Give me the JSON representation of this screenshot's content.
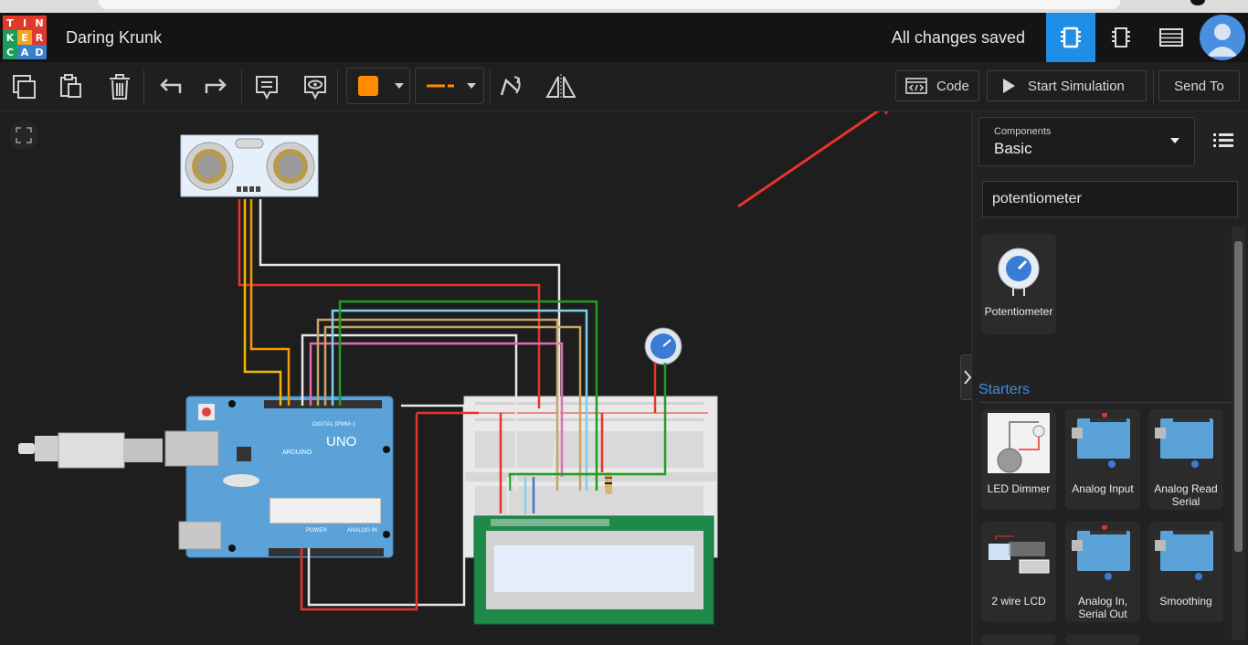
{
  "app": {
    "logo_letters": [
      "T",
      "I",
      "N",
      "K",
      "E",
      "R",
      "C",
      "A",
      "D"
    ],
    "logo_colors": [
      "#e0392b",
      "#e0392b",
      "#e0392b",
      "#1a9d5b",
      "#f2a31b",
      "#e0392b",
      "#1a9d5b",
      "#3a7fc8",
      "#3a7fc8"
    ],
    "title": "Daring Krunk",
    "status": "All changes saved"
  },
  "views": [
    {
      "name": "circuit-view",
      "active": true
    },
    {
      "name": "schematic-view",
      "active": false
    },
    {
      "name": "component-list-view",
      "active": false
    }
  ],
  "toolbar": {
    "tools": [
      "copy",
      "paste",
      "delete",
      "undo",
      "redo",
      "notes",
      "notes-visibility"
    ],
    "wire_color": "#ff8c00",
    "wire_type_color": "#ff8c00",
    "right_tools": [
      "rotate",
      "flip"
    ],
    "code_label": "Code",
    "simulate_label": "Start Simulation",
    "send_label": "Send To"
  },
  "panel": {
    "components_label": "Components",
    "components_value": "Basic",
    "search_value": "potentiometer",
    "results": [
      {
        "label": "Potentiometer",
        "icon": "potentiometer-icon"
      }
    ],
    "starters_label": "Starters",
    "starters": [
      {
        "label": "LED Dimmer"
      },
      {
        "label": "Analog Input"
      },
      {
        "label": "Analog Read Serial"
      },
      {
        "label": "2 wire LCD"
      },
      {
        "label": "Analog In, Serial Out"
      },
      {
        "label": "Smoothing"
      }
    ]
  },
  "canvas": {
    "arduino_brand": "ARDUINO",
    "arduino_model": "UNO",
    "digital_label": "DIGITAL (PWM~)",
    "power_label": "POWER",
    "analog_label": "ANALOG IN",
    "annotation_color": "#e8332a"
  }
}
